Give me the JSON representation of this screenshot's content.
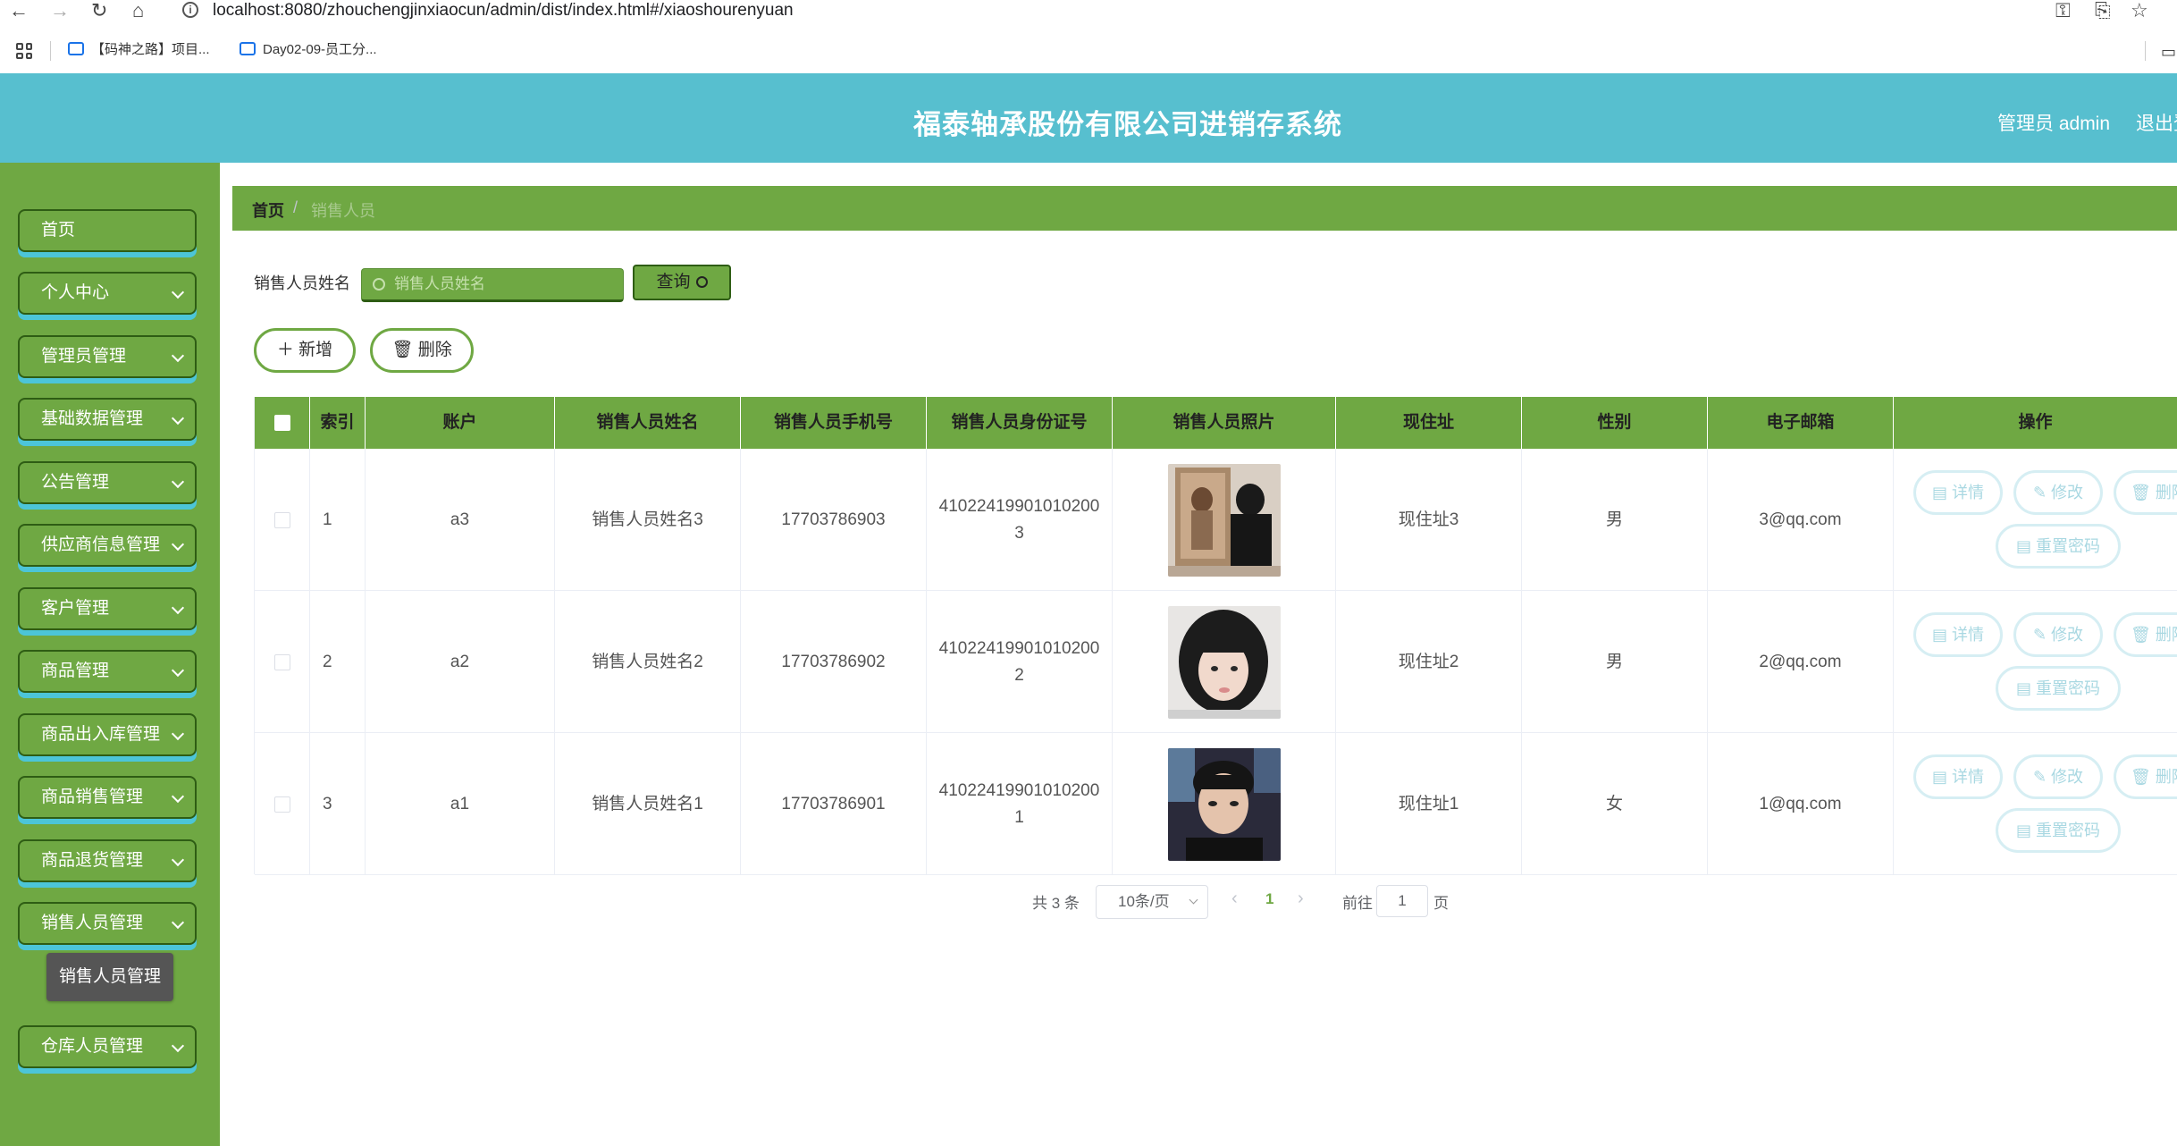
{
  "browser": {
    "url": "localhost:8080/zhouchengjinxiaocun/admin/dist/index.html#/xiaoshourenyuan",
    "bookmarks": [
      "【码神之路】项目...",
      "Day02-09-员工分..."
    ]
  },
  "header": {
    "title": "福泰轴承股份有限公司进销存系统",
    "user": "管理员 admin",
    "logout": "退出登录"
  },
  "sidebar": {
    "items": [
      {
        "label": "首页",
        "has_children": false
      },
      {
        "label": "个人中心",
        "has_children": true
      },
      {
        "label": "管理员管理",
        "has_children": true
      },
      {
        "label": "基础数据管理",
        "has_children": true
      },
      {
        "label": "公告管理",
        "has_children": true
      },
      {
        "label": "供应商信息管理",
        "has_children": true
      },
      {
        "label": "客户管理",
        "has_children": true
      },
      {
        "label": "商品管理",
        "has_children": true
      },
      {
        "label": "商品出入库管理",
        "has_children": true
      },
      {
        "label": "商品销售管理",
        "has_children": true
      },
      {
        "label": "商品退货管理",
        "has_children": true
      },
      {
        "label": "销售人员管理",
        "has_children": true
      },
      {
        "label": "仓库人员管理",
        "has_children": true
      }
    ],
    "submenu_active": "销售人员管理"
  },
  "breadcrumb": {
    "home": "首页",
    "separator": "/",
    "current": "销售人员"
  },
  "search": {
    "label": "销售人员姓名",
    "placeholder": "销售人员姓名",
    "button": "查询"
  },
  "actions": {
    "add": "新增",
    "delete": "删除"
  },
  "table": {
    "columns": [
      "",
      "索引",
      "账户",
      "销售人员姓名",
      "销售人员手机号",
      "销售人员身份证号",
      "销售人员照片",
      "现住址",
      "性别",
      "电子邮箱",
      "操作"
    ],
    "rows": [
      {
        "index": "1",
        "account": "a3",
        "name": "销售人员姓名3",
        "phone": "17703786903",
        "id_card_1": "41022419901010200",
        "id_card_2": "3",
        "photo": "photo-3",
        "address": "现住址3",
        "gender": "男",
        "email": "3@qq.com"
      },
      {
        "index": "2",
        "account": "a2",
        "name": "销售人员姓名2",
        "phone": "17703786902",
        "id_card_1": "41022419901010200",
        "id_card_2": "2",
        "photo": "photo-2",
        "address": "现住址2",
        "gender": "男",
        "email": "2@qq.com"
      },
      {
        "index": "3",
        "account": "a1",
        "name": "销售人员姓名1",
        "phone": "17703786901",
        "id_card_1": "41022419901010200",
        "id_card_2": "1",
        "photo": "photo-1",
        "address": "现住址1",
        "gender": "女",
        "email": "1@qq.com"
      }
    ],
    "ops": {
      "detail": "详情",
      "edit": "修改",
      "delete": "删除",
      "reset": "重置密码"
    }
  },
  "pagination": {
    "total": "共 3 条",
    "page_size": "10条/页",
    "current_page": "1",
    "goto_label": "前往",
    "goto_value": "1",
    "goto_unit": "页"
  },
  "colors": {
    "header": "#57bfcf",
    "sidebar": "#6fa843",
    "accent": "#6fa843",
    "menu_shadow": "#4cc5d8"
  }
}
